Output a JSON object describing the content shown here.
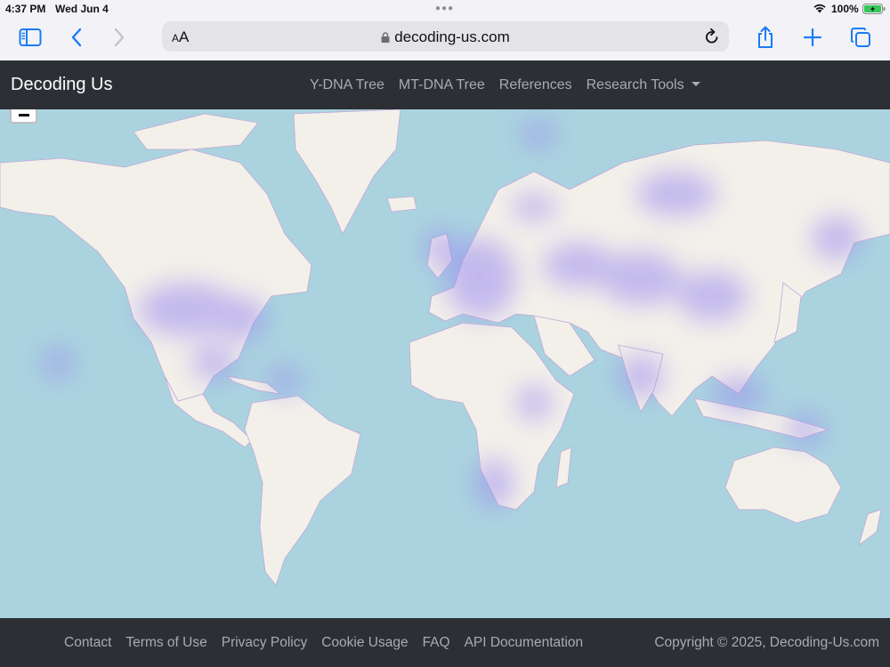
{
  "status_bar": {
    "time": "4:37 PM",
    "date": "Wed Jun 4",
    "battery": "100%"
  },
  "browser": {
    "text_size_label": "AA",
    "url": "decoding-us.com",
    "icons": [
      "sidebar-icon",
      "back-icon",
      "forward-icon",
      "lock-icon",
      "reload-icon",
      "share-icon",
      "new-tab-icon",
      "tabs-icon"
    ]
  },
  "navbar": {
    "brand": "Decoding Us",
    "links": [
      {
        "label": "Y-DNA Tree"
      },
      {
        "label": "MT-DNA Tree"
      },
      {
        "label": "References"
      },
      {
        "label": "Research Tools"
      }
    ]
  },
  "map": {
    "type": "heatmap",
    "colors": {
      "ocean": "#aad3df",
      "land": "#f2efe9",
      "heat": "#9b8cf0",
      "border": "#b89ec9"
    }
  },
  "footer": {
    "links": [
      {
        "label": "Contact"
      },
      {
        "label": "Terms of Use"
      },
      {
        "label": "Privacy Policy"
      },
      {
        "label": "Cookie Usage"
      },
      {
        "label": "FAQ"
      },
      {
        "label": "API Documentation"
      }
    ],
    "copyright": "Copyright © 2025, Decoding-Us.com"
  }
}
